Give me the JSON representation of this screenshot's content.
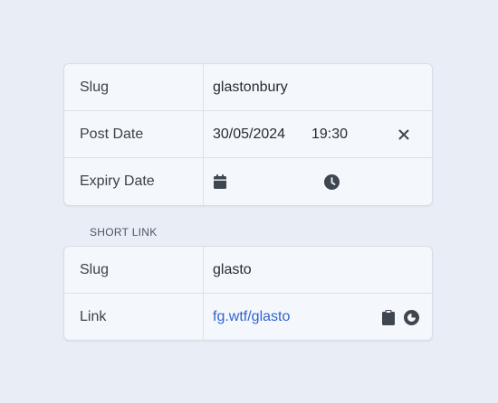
{
  "meta": {
    "slug": {
      "label": "Slug",
      "value": "glastonbury"
    },
    "post_date": {
      "label": "Post Date",
      "date": "30/05/2024",
      "time": "19:30",
      "clear_icon": "close-icon"
    },
    "expiry_date": {
      "label": "Expiry Date",
      "date_icon": "calendar-icon",
      "time_icon": "clock-icon"
    }
  },
  "short_link": {
    "section_title": "SHORT LINK",
    "slug": {
      "label": "Slug",
      "value": "glasto"
    },
    "link": {
      "label": "Link",
      "value": "fg.wtf/glasto",
      "copy_icon": "clipboard-icon",
      "regenerate_icon": "refresh-icon"
    }
  },
  "colors": {
    "link": "#2f63d0",
    "background": "#e9eef6",
    "panel": "#f4f7fb",
    "icon": "#3f4650"
  }
}
